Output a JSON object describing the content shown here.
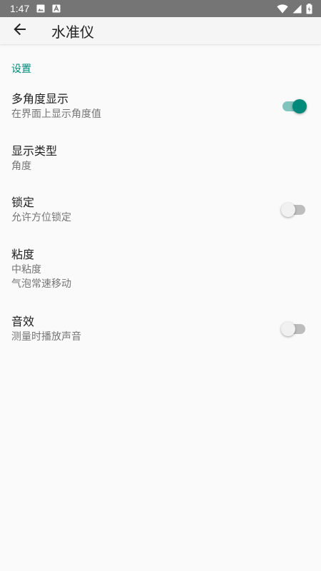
{
  "status_bar": {
    "time": "1:47",
    "icons_left": [
      "image-icon",
      "text-box-icon"
    ],
    "icons_right": [
      "wifi-icon",
      "signal-icon",
      "battery-icon"
    ]
  },
  "app_bar": {
    "back_icon": "arrow-left-icon",
    "title": "水准仪"
  },
  "settings": {
    "section_header": "设置",
    "items": [
      {
        "title": "多角度显示",
        "summary": "在界面上显示角度值",
        "switch": true
      },
      {
        "title": "显示类型",
        "summary": "角度"
      },
      {
        "title": "锁定",
        "summary": "允许方位锁定",
        "switch": false
      },
      {
        "title": "粘度",
        "summary": "中粘度",
        "summary2": "气泡常速移动"
      },
      {
        "title": "音效",
        "summary": "测量时播放声音",
        "switch": false
      }
    ]
  },
  "colors": {
    "accent": "#00897b",
    "status_bar": "#757575",
    "app_bar": "#f5f5f5",
    "background": "#fafafa"
  }
}
